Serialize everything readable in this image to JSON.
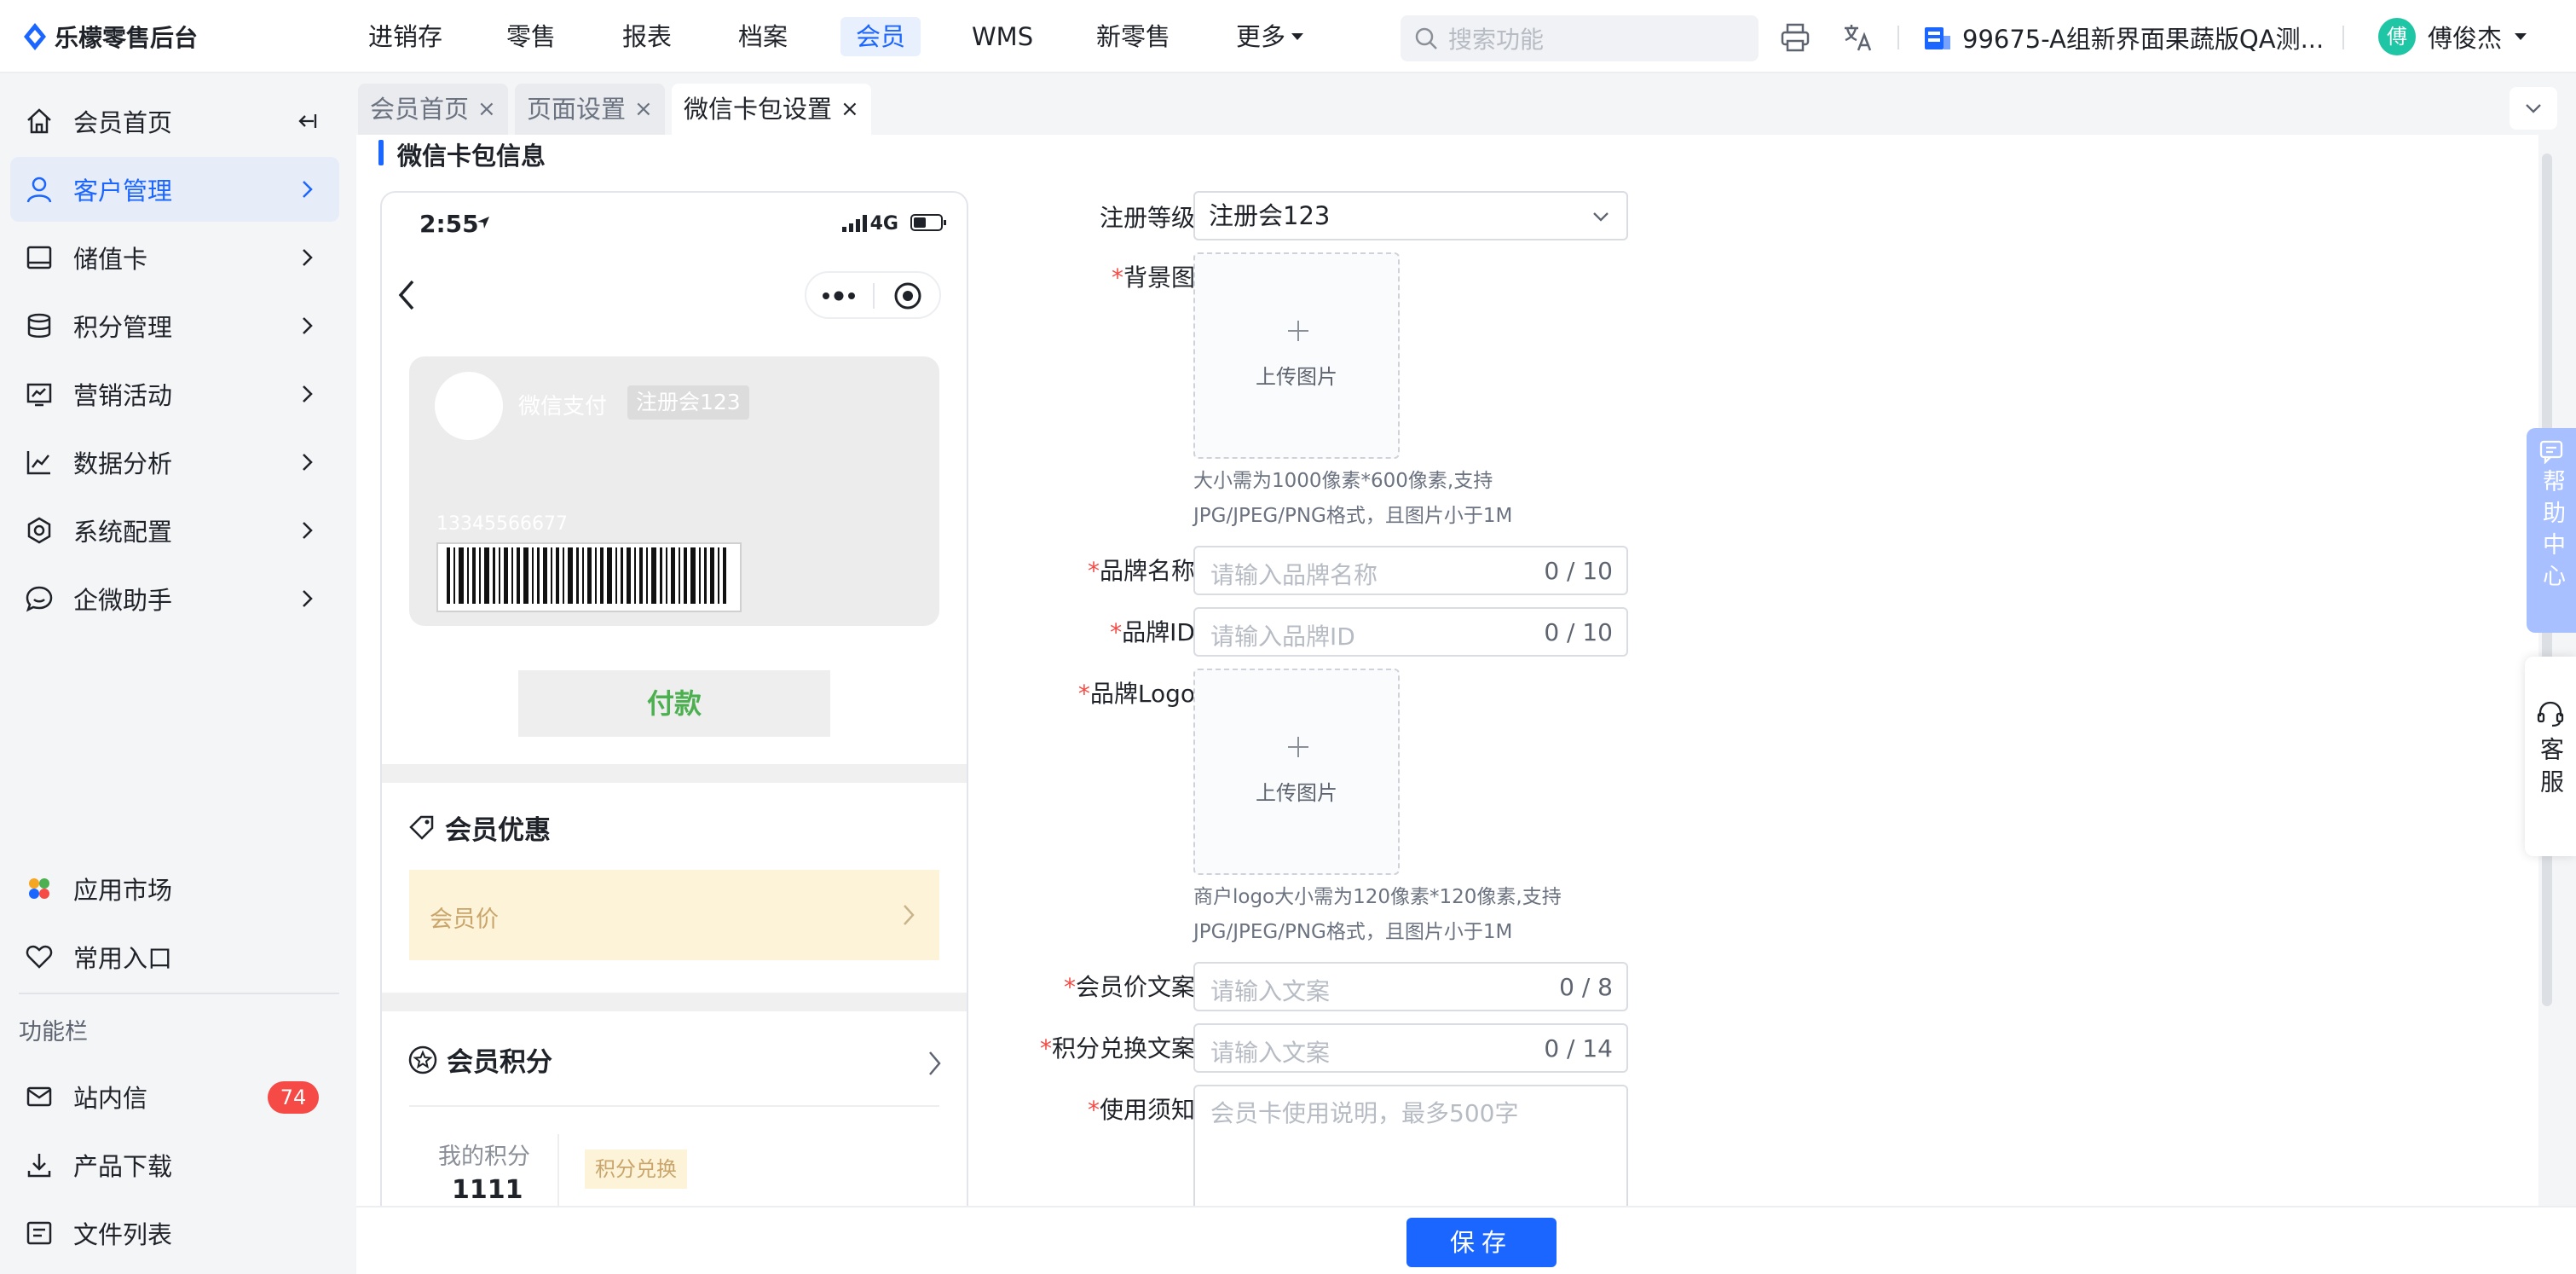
{
  "app": {
    "title": "乐檬零售后台"
  },
  "nav": {
    "items": [
      "进销存",
      "零售",
      "报表",
      "档案",
      "会员",
      "WMS",
      "新零售",
      "更多"
    ],
    "active": "会员"
  },
  "search": {
    "placeholder": "搜索功能"
  },
  "store": {
    "name": "99675-A组新界面果蔬版QA测..."
  },
  "user": {
    "name": "傅俊杰",
    "avatar_char": "傅"
  },
  "sidebar": {
    "items": [
      {
        "label": "会员首页",
        "icon": "home-icon"
      },
      {
        "label": "客户管理",
        "icon": "user-icon",
        "active": true
      },
      {
        "label": "储值卡",
        "icon": "tablet-icon"
      },
      {
        "label": "积分管理",
        "icon": "database-icon"
      },
      {
        "label": "营销活动",
        "icon": "presentation-icon"
      },
      {
        "label": "数据分析",
        "icon": "line-chart-icon"
      },
      {
        "label": "系统配置",
        "icon": "settings-icon"
      },
      {
        "label": "企微助手",
        "icon": "chat-icon"
      }
    ],
    "bottom": [
      {
        "label": "应用市场",
        "icon": "app-market-icon"
      },
      {
        "label": "常用入口",
        "icon": "heart-icon"
      }
    ],
    "section_label": "功能栏",
    "tools": [
      {
        "label": "站内信",
        "icon": "mail-icon",
        "badge": "74"
      },
      {
        "label": "产品下载",
        "icon": "download-icon"
      },
      {
        "label": "文件列表",
        "icon": "file-list-icon"
      }
    ]
  },
  "tabs": [
    {
      "label": "会员首页",
      "active": false
    },
    {
      "label": "页面设置",
      "active": false
    },
    {
      "label": "微信卡包设置",
      "active": true
    }
  ],
  "section": {
    "title": "微信卡包信息"
  },
  "phone": {
    "time": "2:55",
    "network": "4G",
    "card": {
      "pay_label": "微信支付",
      "level": "注册会123",
      "number": "13345566677"
    },
    "pay_button": "付款",
    "vip_benefits": {
      "title": "会员优惠",
      "vip_price": "会员价"
    },
    "points": {
      "title": "会员积分",
      "my_points_label": "我的积分",
      "my_points_value": "1111",
      "exchange": "积分兑换"
    }
  },
  "form": {
    "level": {
      "label": "注册等级",
      "value": "注册会123"
    },
    "background": {
      "label": "背景图",
      "upload": "上传图片",
      "hint": [
        "大小需为1000像素*600像素,支持",
        "JPG/JPEG/PNG格式，且图片小于1M"
      ]
    },
    "brand_name": {
      "label": "品牌名称",
      "placeholder": "请输入品牌名称",
      "count": "0 / 10"
    },
    "brand_id": {
      "label": "品牌ID",
      "placeholder": "请输入品牌ID",
      "count": "0 / 10"
    },
    "brand_logo": {
      "label": "品牌Logo",
      "upload": "上传图片",
      "hint": [
        "商户logo大小需为120像素*120像素,支持",
        "JPG/JPEG/PNG格式，且图片小于1M"
      ]
    },
    "vip_price_text": {
      "label": "会员价文案",
      "placeholder": "请输入文案",
      "count": "0 / 8"
    },
    "points_text": {
      "label": "积分兑换文案",
      "placeholder": "请输入文案",
      "count": "0 / 14"
    },
    "usage": {
      "label": "使用须知",
      "placeholder": "会员卡使用说明，最多500字"
    },
    "required_mark": "*"
  },
  "help": {
    "help_center": "帮助中心",
    "customer_service": "客服"
  },
  "footer": {
    "save": "保存"
  },
  "colors": {
    "primary": "#1a66ff",
    "danger": "#f54a45",
    "pay_green": "#4caf50",
    "vip_bg": "#fdf3d8"
  }
}
